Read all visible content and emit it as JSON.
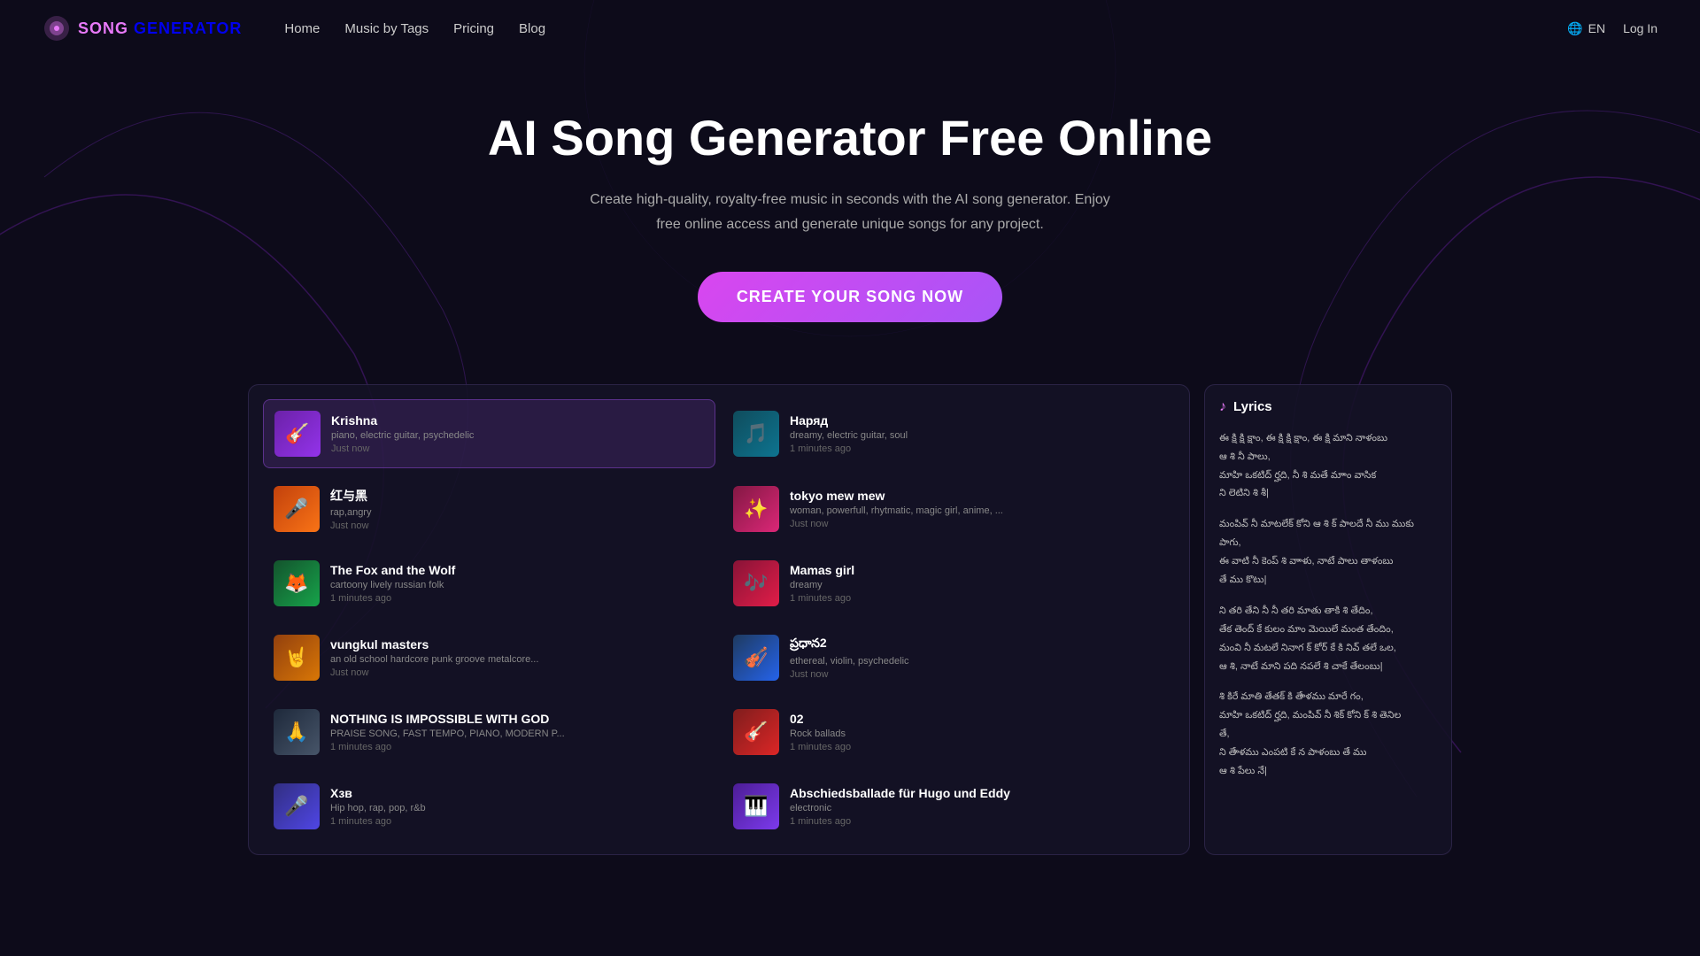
{
  "site": {
    "logo_song": "SONG",
    "logo_generator": "GENERATOR"
  },
  "nav": {
    "links": [
      {
        "label": "Home",
        "name": "home"
      },
      {
        "label": "Music by Tags",
        "name": "music-by-tags"
      },
      {
        "label": "Pricing",
        "name": "pricing"
      },
      {
        "label": "Blog",
        "name": "blog"
      }
    ],
    "lang": "EN",
    "login": "Log In"
  },
  "hero": {
    "title": "AI Song Generator Free Online",
    "subtitle": "Create high-quality, royalty-free music in seconds with the AI song generator. Enjoy free online access and generate unique songs for any project.",
    "cta": "CREATE YOUR SONG NOW"
  },
  "lyrics_panel": {
    "header": "Lyrics",
    "paragraphs": [
      "ఈ క్షి క్షి క్షాం, ఈ క్షి క్షి క్షాం, ఈ క్షి మాని నాళంబు\nఆ శి నీ పాలు,\nమాహి ఒకటిద్ ర్హది, నీ శి మతే మాాం వాసిక\nని లెటిని శి శీ|",
      "మంపివ్ నీ మాటలేక్ కోని ఆ శి క్ పాలదే నీ ము ముకు\nపాగు,\nఈ వాటి నీ కెంప్ శి వాాళు, నాటే పాలు తాళంబు\nతే ము కొటు|",
      "ని తరి తేని నీ నీ తరి మాతు తాకి శి తేదిం,\nతేక తెంద్ కే కులం మాం మెయిలే మంత తేందిం,\nమంవి నీ మటలే నినాగ క్ కోర్ కే కి నివ్‌ తలే ఒల,\nఆ శి, నాటే మాని పది నపలే శి చాకే తేలంబు|",
      "శి కిరే మాతి తేతక్ కి తేాళము మారే గం,\nమాహి ఒకటిద్ ర్హది, మంపివ్ నీ శిక్ కోని క్ శి తెనిల\nతే,\nని తేాళము ఎంపటి కే న పాళంబు తే ము\nఆ శి పేలు నే|"
    ]
  },
  "songs": [
    {
      "id": "krishna",
      "title": "Krishna",
      "tags": "piano, electric guitar, psychedelic",
      "time": "Just now",
      "thumb_class": "thumb-purple",
      "emoji": "🎸",
      "active": true
    },
    {
      "id": "narad",
      "title": "Наряд",
      "tags": "dreamy, electric guitar, soul",
      "time": "1 minutes ago",
      "thumb_class": "thumb-dark-teal",
      "emoji": "🎵",
      "active": false
    },
    {
      "id": "red-black",
      "title": "红与黑",
      "tags": "rap,angry",
      "time": "Just now",
      "thumb_class": "thumb-orange",
      "emoji": "🎤",
      "active": false
    },
    {
      "id": "tokyo-mew-mew",
      "title": "tokyo mew mew",
      "tags": "woman, powerfull, rhytmatic, magic girl, anime, ...",
      "time": "Just now",
      "thumb_class": "thumb-magenta",
      "emoji": "✨",
      "active": false
    },
    {
      "id": "fox-wolf",
      "title": "The Fox and the Wolf",
      "tags": "cartoony lively russian folk",
      "time": "1 minutes ago",
      "thumb_class": "thumb-green",
      "emoji": "🦊",
      "active": false
    },
    {
      "id": "mamas-girl",
      "title": "Mamas girl",
      "tags": "dreamy",
      "time": "1 minutes ago",
      "thumb_class": "thumb-rose",
      "emoji": "🎶",
      "active": false
    },
    {
      "id": "vungkul-masters",
      "title": "vungkul masters",
      "tags": "an old school hardcore punk groove metalcore...",
      "time": "Just now",
      "thumb_class": "thumb-amber",
      "emoji": "🤘",
      "active": false
    },
    {
      "id": "pradhana2",
      "title": "ప్రధాన2",
      "tags": "ethereal, violin, psychedelic",
      "time": "Just now",
      "thumb_class": "thumb-blue",
      "emoji": "🎻",
      "active": false
    },
    {
      "id": "nothing-impossible",
      "title": "NOTHING IS IMPOSSIBLE WITH GOD",
      "tags": "PRAISE SONG, FAST TEMPO, PIANO, MODERN P...",
      "time": "1 minutes ago",
      "thumb_class": "thumb-slate",
      "emoji": "🙏",
      "active": false
    },
    {
      "id": "02",
      "title": "02",
      "tags": "Rock ballads",
      "time": "1 minutes ago",
      "thumb_class": "thumb-red",
      "emoji": "🎸",
      "active": false
    },
    {
      "id": "x3v",
      "title": "Хзв",
      "tags": "Hip hop, rap, pop, r&b",
      "time": "1 minutes ago",
      "thumb_class": "thumb-indigo",
      "emoji": "🎤",
      "active": false
    },
    {
      "id": "abschiedsballade",
      "title": "Abschiedsballade für Hugo und Eddy",
      "tags": "electronic",
      "time": "1 minutes ago",
      "thumb_class": "thumb-violet",
      "emoji": "🎹",
      "active": false
    }
  ]
}
